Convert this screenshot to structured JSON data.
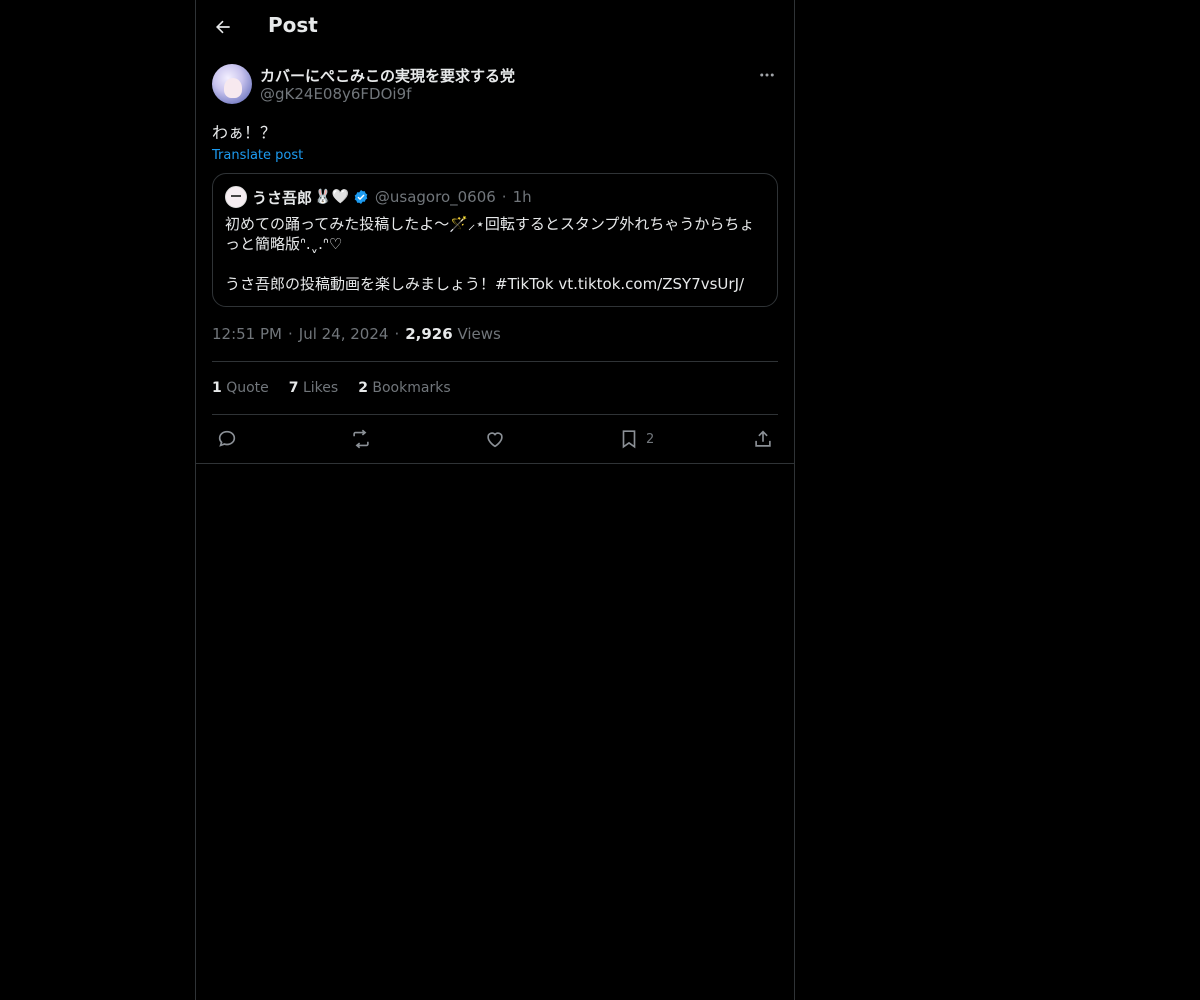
{
  "header": {
    "title": "Post",
    "back_icon": "arrow-left-icon"
  },
  "post": {
    "author_name": "カバーにぺこみこの実現を要求する党",
    "author_handle": "@gK24E08y6FDOi9f",
    "text": "わぁ！？",
    "translate_label": "Translate post",
    "quote": {
      "name": "うさ吾郎",
      "name_emoji": "🐰🤍",
      "handle": "@usagoro_0606",
      "dot": "·",
      "time": "1h",
      "line1": "初めての踊ってみた投稿したよ〜🪄⸝⋆回転するとスタンプ外れちゃうからちょっと簡略版ᐢ.ˬ.ᐢ♡",
      "line2": "うさ吾郎の投稿動画を楽しみましょう！#TikTok vt.tiktok.com/ZSY7vsUrJ/"
    },
    "time": "12:51 PM",
    "date": "Jul 24, 2024",
    "views_count": "2,926",
    "views_label": "Views",
    "sep": "·"
  },
  "stats": {
    "quotes_count": "1",
    "quotes_label": "Quote",
    "likes_count": "7",
    "likes_label": "Likes",
    "bookmarks_count": "2",
    "bookmarks_label": "Bookmarks"
  },
  "actions": {
    "bookmark_count": "2"
  },
  "colors": {
    "background": "#000000",
    "text": "#e7e9ea",
    "muted": "#71767b",
    "accent": "#1d9bf0",
    "border": "#2f3336"
  }
}
